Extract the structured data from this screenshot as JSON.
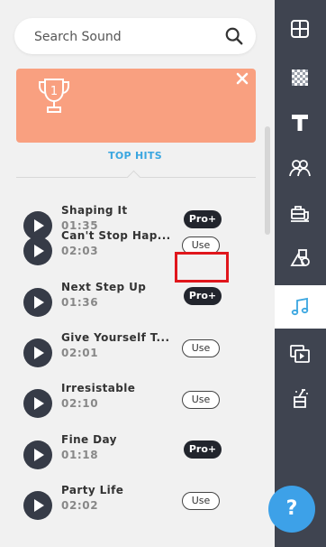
{
  "search": {
    "placeholder": "Search Sound",
    "icon": "search-icon"
  },
  "banner": {
    "trophy_number": "1",
    "color": "#f9a080"
  },
  "tabs": {
    "active": "TOP HITS"
  },
  "sounds": [
    {
      "title": "Shaping It",
      "duration": "01:35",
      "badge": "Pro+"
    },
    {
      "title": "Can't Stop Hap...",
      "duration": "02:03",
      "badge": "Use"
    },
    {
      "title": "Next Step Up",
      "duration": "01:36",
      "badge": "Pro+"
    },
    {
      "title": "Give Yourself T...",
      "duration": "02:01",
      "badge": "Use"
    },
    {
      "title": "Irresistable",
      "duration": "02:10",
      "badge": "Use"
    },
    {
      "title": "Fine Day",
      "duration": "01:18",
      "badge": "Pro+"
    },
    {
      "title": "Party Life",
      "duration": "02:02",
      "badge": "Use"
    }
  ],
  "sidebar": {
    "items": [
      {
        "name": "layout-icon"
      },
      {
        "name": "background-icon"
      },
      {
        "name": "text-icon"
      },
      {
        "name": "people-icon"
      },
      {
        "name": "props-icon"
      },
      {
        "name": "shapes-icon"
      },
      {
        "name": "music-icon",
        "active": true
      },
      {
        "name": "video-icon"
      },
      {
        "name": "effects-icon"
      }
    ]
  },
  "help": {
    "label": "?"
  }
}
